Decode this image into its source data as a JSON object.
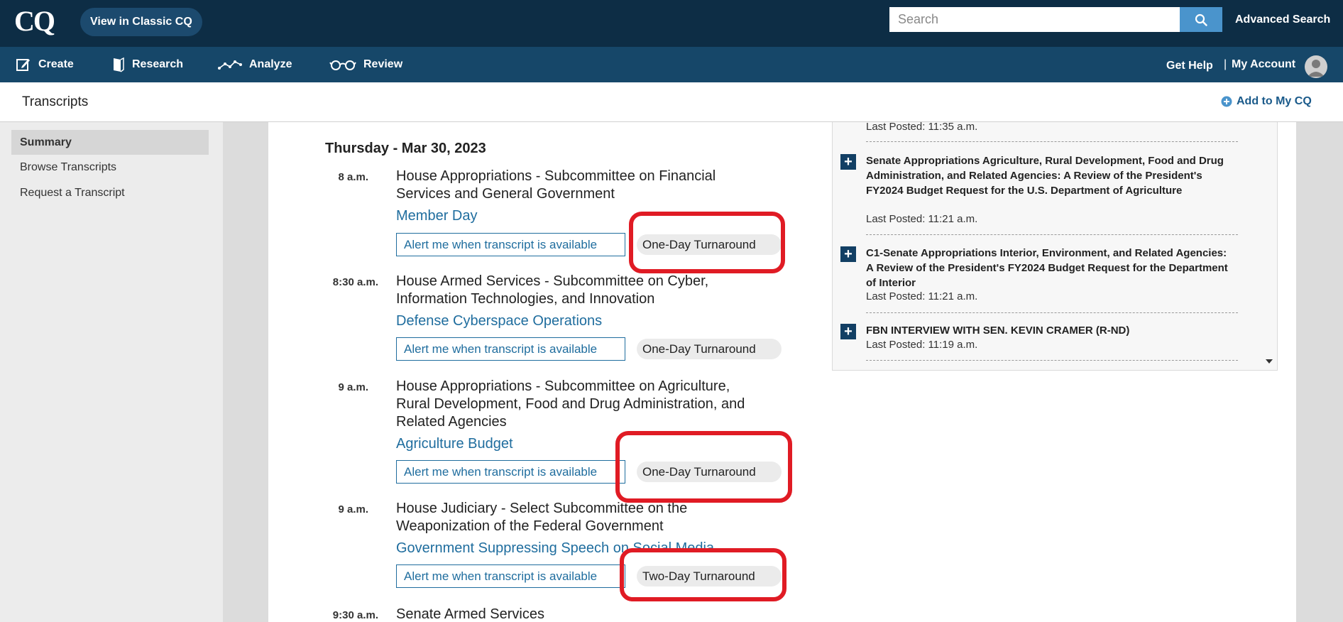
{
  "app": {
    "logo": "CQ",
    "classic_button": "View in Classic CQ"
  },
  "search": {
    "placeholder": "Search",
    "advanced_label": "Advanced Search"
  },
  "nav": {
    "items": [
      {
        "label": "Create",
        "icon": "edit-icon"
      },
      {
        "label": "Research",
        "icon": "book-icon"
      },
      {
        "label": "Analyze",
        "icon": "trend-line-icon"
      },
      {
        "label": "Review",
        "icon": "glasses-icon"
      }
    ],
    "help": "Get Help",
    "separator": "|",
    "account": "My Account"
  },
  "page": {
    "title": "Transcripts",
    "add_to_my_cq": "Add to My CQ"
  },
  "sidebar": {
    "items": [
      {
        "label": "Summary",
        "active": true
      },
      {
        "label": "Browse Transcripts",
        "active": false
      },
      {
        "label": "Request a Transcript",
        "active": false
      }
    ]
  },
  "schedule": {
    "date": "Thursday - Mar 30, 2023",
    "alert_label": "Alert me when transcript is available",
    "events": [
      {
        "time": "8 a.m.",
        "committee": "House Appropriations - Subcommittee on Financial Services and General Government",
        "hearing": "Member Day",
        "turnaround": "One-Day Turnaround"
      },
      {
        "time": "8:30 a.m.",
        "committee": "House Armed Services - Subcommittee on Cyber, Information Technologies, and Innovation",
        "hearing": "Defense Cyberspace Operations",
        "turnaround": "One-Day Turnaround"
      },
      {
        "time": "9 a.m.",
        "committee": "House Appropriations - Subcommittee on Agriculture, Rural Development, Food and Drug Administration, and Related Agencies",
        "hearing": "Agriculture Budget",
        "turnaround": "One-Day Turnaround"
      },
      {
        "time": "9 a.m.",
        "committee": "House Judiciary - Select Subcommittee on the Weaponization of the Federal Government",
        "hearing": "Government Suppressing Speech on Social Media",
        "turnaround": "Two-Day Turnaround"
      },
      {
        "time": "9:30 a.m.",
        "committee": "Senate Armed Services"
      }
    ]
  },
  "recent": {
    "top_posted": "Last Posted: 11:35 a.m.",
    "items": [
      {
        "title": "Senate Appropriations Agriculture, Rural Development, Food and Drug Administration, and Related Agencies: A Review of the President's FY2024 Budget Request for the U.S. Department of Agriculture",
        "posted": "Last Posted: 11:21 a.m."
      },
      {
        "title": "C1-Senate Appropriations Interior, Environment, and Related Agencies: A Review of the President's FY2024 Budget Request for the Department of Interior",
        "posted": "Last Posted: 11:21 a.m."
      },
      {
        "title": "FBN INTERVIEW WITH SEN. KEVIN CRAMER (R-ND)",
        "posted": "Last Posted: 11:19 a.m."
      }
    ],
    "expand_glyph": "+"
  },
  "colors": {
    "topbar": "#0d2d45",
    "navbar": "#164769",
    "link": "#1f6d9e",
    "highlight": "#e01b24",
    "search_button": "#4a94cc"
  }
}
